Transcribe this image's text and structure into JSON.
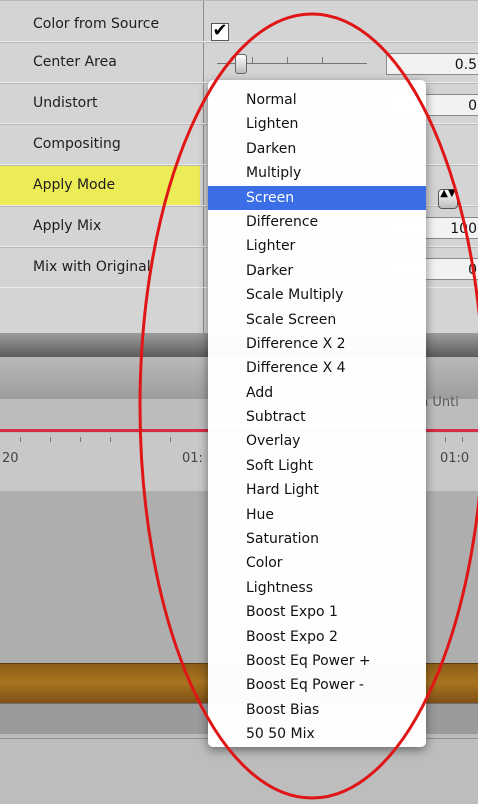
{
  "inspector": {
    "rows": [
      {
        "label": "Color from Source",
        "checked": true
      },
      {
        "label": "Center Area",
        "value": "0.5"
      },
      {
        "label": "Undistort",
        "value": "0"
      },
      {
        "label": "Compositing"
      },
      {
        "label": "Apply Mode",
        "highlighted": true
      },
      {
        "label": "Apply Mix",
        "value": "100"
      },
      {
        "label": "Mix with Original",
        "value": "0"
      }
    ],
    "checkbox_glyph": "✔",
    "popup_glyph": "▲▼"
  },
  "timeline": {
    "hint_text": "n Unti",
    "timecodes": [
      "20",
      "01:",
      "01:0"
    ],
    "colors": {
      "playhead_line": "#d62b45",
      "track": "#a8741f"
    }
  },
  "menu": {
    "items": [
      "Normal",
      "Lighten",
      "Darken",
      "Multiply",
      "Screen",
      "Difference",
      "Lighter",
      "Darker",
      "Scale Multiply",
      "Scale Screen",
      "Difference X 2",
      "Difference X 4",
      "Add",
      "Subtract",
      "Overlay",
      "Soft Light",
      "Hard Light",
      "Hue",
      "Saturation",
      "Color",
      "Lightness",
      "Boost Expo 1",
      "Boost Expo 2",
      "Boost Eq Power +",
      "Boost Eq Power -",
      "Boost Bias",
      "50 50 Mix"
    ],
    "selected_index": 4,
    "selection_color": "#3b6ee6"
  },
  "annotation": {
    "ellipse_color": "#e01616"
  }
}
